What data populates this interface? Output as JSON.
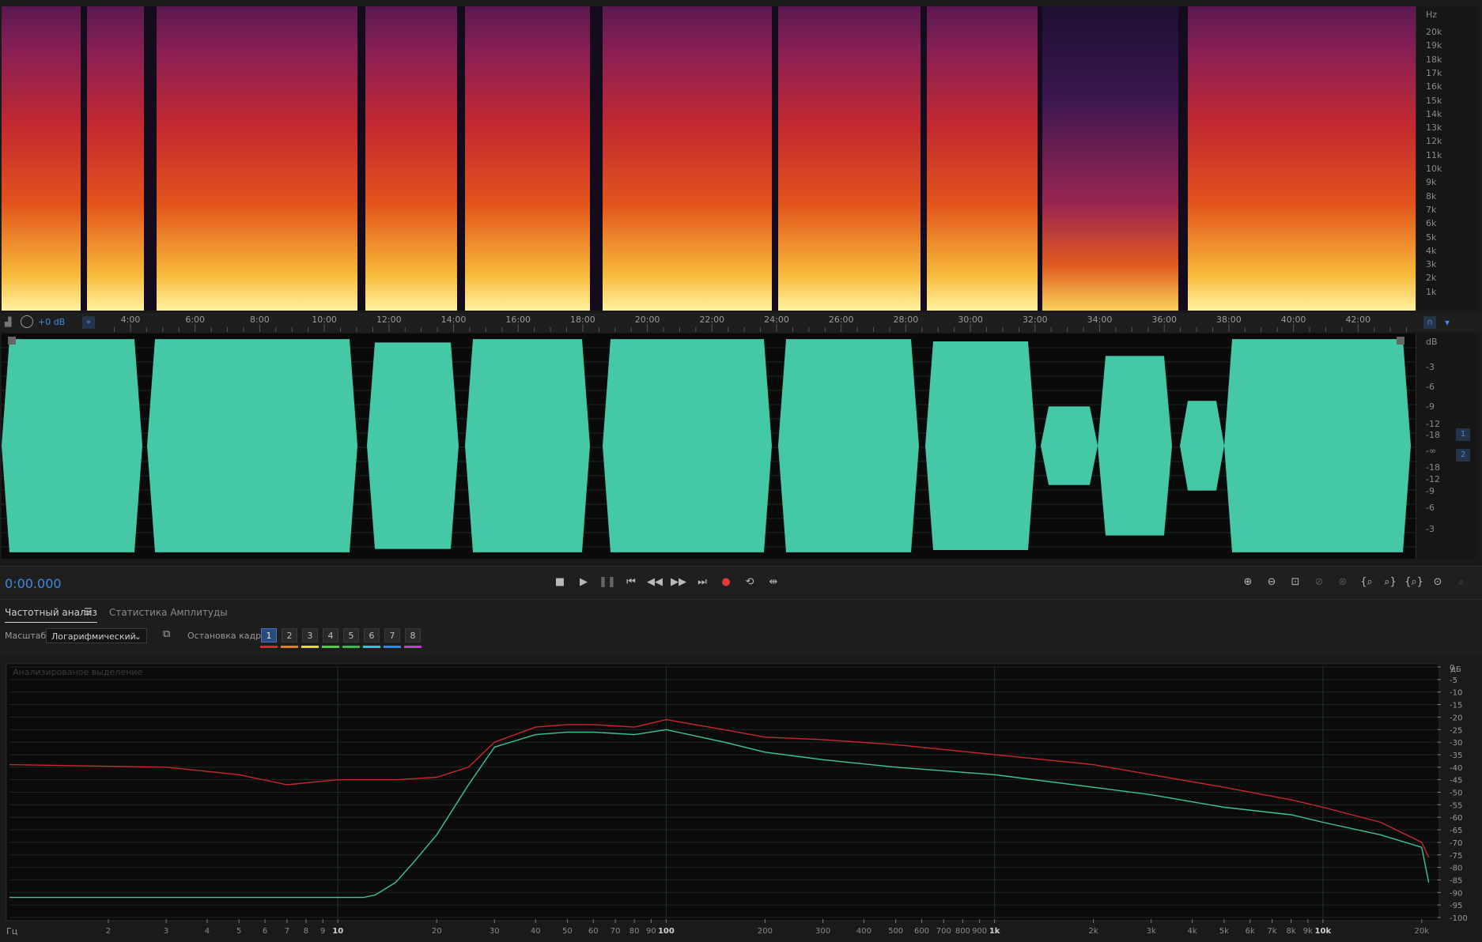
{
  "spectrogram": {
    "unit": "Hz",
    "freq_labels": [
      "20k",
      "19k",
      "18k",
      "17k",
      "16k",
      "15k",
      "14k",
      "13k",
      "12k",
      "11k",
      "10k",
      "9k",
      "8k",
      "7k",
      "6k",
      "5k",
      "4k",
      "3k",
      "2k",
      "1k"
    ]
  },
  "ruler": {
    "gain": "+0 dB",
    "time_labels": [
      "4:00",
      "6:00",
      "8:00",
      "10:00",
      "12:00",
      "14:00",
      "16:00",
      "18:00",
      "20:00",
      "22:00",
      "24:00",
      "26:00",
      "28:00",
      "30:00",
      "32:00",
      "34:00",
      "36:00",
      "38:00",
      "40:00",
      "42:00",
      "4"
    ]
  },
  "waveform": {
    "unit": "dB",
    "db_labels": [
      "-3",
      "-6",
      "-9",
      "-12",
      "-18",
      "-∞",
      "-18",
      "-12",
      "-9",
      "-6",
      "-3"
    ],
    "channel_badges": [
      "1",
      "2"
    ],
    "color": "#45c8a6"
  },
  "transport": {
    "time": "0:00.000",
    "buttons": [
      "stop-icon",
      "play-icon",
      "pause-icon",
      "go-to-start-icon",
      "rewind-icon",
      "fast-forward-icon",
      "go-to-end-icon",
      "record-icon",
      "loop-icon",
      "skip-selection-icon"
    ],
    "zoom_buttons": [
      "zoom-in-amplitude-icon",
      "zoom-out-amplitude-icon",
      "zoom-fit-icon",
      "zoom-reset-icon",
      "zoom-selection-icon",
      "zoom-in-left-icon",
      "zoom-in-right-icon",
      "zoom-full-icon",
      "zoom-out-time-icon",
      "zoom-in-time-icon"
    ]
  },
  "panel": {
    "tab_frequency": "Частотный анализ",
    "tab_stats": "Статистика Амплитуды",
    "scale_label": "Масштаб:",
    "scale_value": "Логарифмический",
    "freeze_label": "Остановка кадра:",
    "frames": [
      "1",
      "2",
      "3",
      "4",
      "5",
      "6",
      "7",
      "8"
    ],
    "frame_colors": [
      "#d62b2b",
      "#e0801f",
      "#e5d92a",
      "#4fcf3a",
      "#3cb84d",
      "#2ec7d6",
      "#2d8ae0",
      "#c43ad6"
    ]
  },
  "chart_data": {
    "type": "line",
    "title": "Анализированое выделение",
    "xlabel": "Гц",
    "ylabel": "дБ",
    "x_scale": "log",
    "xlim": [
      1,
      22000
    ],
    "ylim": [
      -100,
      0
    ],
    "x_tick_labels": [
      "2",
      "3",
      "4",
      "5",
      "6",
      "7",
      "8",
      "9",
      "10",
      "20",
      "30",
      "40",
      "50",
      "60",
      "70",
      "80",
      "90",
      "100",
      "200",
      "300",
      "400",
      "500",
      "600",
      "700",
      "800",
      "900",
      "1k",
      "2k",
      "3k",
      "4k",
      "5k",
      "6k",
      "7k",
      "8k",
      "9k",
      "10k",
      "20k"
    ],
    "x_tick_values": [
      2,
      3,
      4,
      5,
      6,
      7,
      8,
      9,
      10,
      20,
      30,
      40,
      50,
      60,
      70,
      80,
      90,
      100,
      200,
      300,
      400,
      500,
      600,
      700,
      800,
      900,
      1000,
      2000,
      3000,
      4000,
      5000,
      6000,
      7000,
      8000,
      9000,
      10000,
      20000
    ],
    "y_ticks": [
      0,
      -5,
      -10,
      -15,
      -20,
      -25,
      -30,
      -35,
      -40,
      -45,
      -50,
      -55,
      -60,
      -65,
      -70,
      -75,
      -80,
      -85,
      -90,
      -95,
      -100
    ],
    "grid": true,
    "series": [
      {
        "color": "#c8282f",
        "x": [
          1,
          3,
          5,
          7,
          10,
          15,
          20,
          25,
          30,
          40,
          50,
          60,
          80,
          100,
          150,
          200,
          300,
          500,
          1000,
          2000,
          3000,
          5000,
          8000,
          10000,
          15000,
          20000,
          21000
        ],
        "y": [
          -39,
          -40,
          -43,
          -47,
          -45,
          -45,
          -44,
          -40,
          -30,
          -24,
          -23,
          -23,
          -24,
          -21,
          -25,
          -28,
          -29,
          -31,
          -35,
          -39,
          -43,
          -48,
          -53,
          -56,
          -62,
          -70,
          -76
        ]
      },
      {
        "color": "#3fc49a",
        "x": [
          1,
          5,
          10,
          12,
          13,
          15,
          17,
          20,
          25,
          30,
          40,
          50,
          60,
          80,
          100,
          150,
          200,
          300,
          500,
          1000,
          2000,
          3000,
          5000,
          8000,
          10000,
          15000,
          20000,
          21000
        ],
        "y": [
          -92,
          -92,
          -92,
          -92,
          -91,
          -86,
          -78,
          -67,
          -47,
          -32,
          -27,
          -26,
          -26,
          -27,
          -25,
          -30,
          -34,
          -37,
          -40,
          -43,
          -48,
          -51,
          -56,
          -59,
          -62,
          -67,
          -72,
          -86
        ]
      }
    ]
  }
}
